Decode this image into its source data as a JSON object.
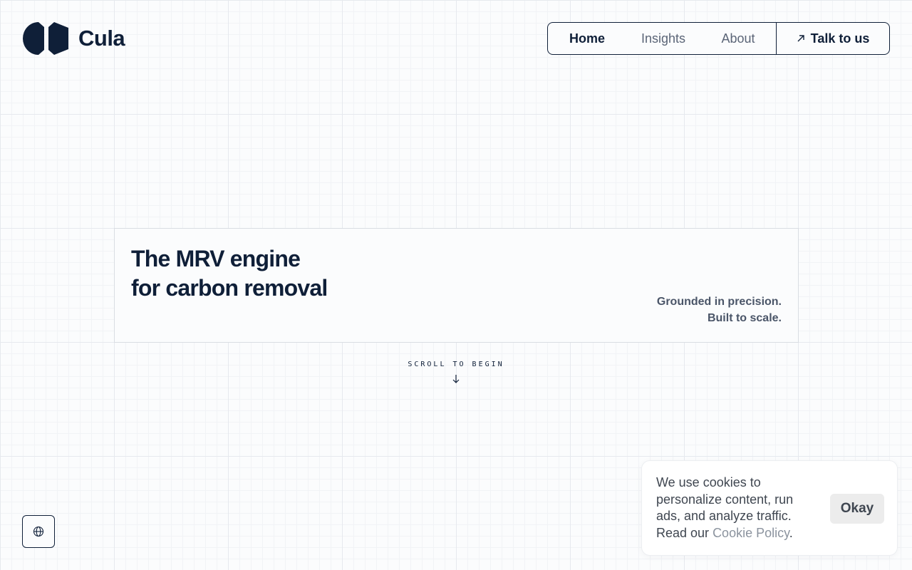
{
  "brand": {
    "name": "Cula",
    "logo_icon": "cula-logo-icon"
  },
  "nav": {
    "items": [
      {
        "label": "Home",
        "active": true
      },
      {
        "label": "Insights",
        "active": false
      },
      {
        "label": "About",
        "active": false
      }
    ],
    "cta": {
      "label": "Talk to us",
      "icon": "arrow-up-right-icon"
    }
  },
  "hero": {
    "title_lines": [
      "The MRV engine",
      "for carbon removal"
    ],
    "tagline_lines": [
      "Grounded in precision.",
      "Built to scale."
    ]
  },
  "scroll_cue": {
    "label": "SCROLL TO BEGIN",
    "icon": "arrow-down-icon"
  },
  "language_button": {
    "icon": "globe-icon"
  },
  "cookie_banner": {
    "text_prefix": "We use cookies to personalize content, run ads, and analyze traffic. Read our ",
    "link_label": "Cookie Policy",
    "text_suffix": ".",
    "button_label": "Okay"
  },
  "colors": {
    "ink": "#0f1f38",
    "muted": "#5b6577",
    "border": "#d9dde3",
    "link": "#8b939e",
    "button_bg": "#ececec"
  }
}
